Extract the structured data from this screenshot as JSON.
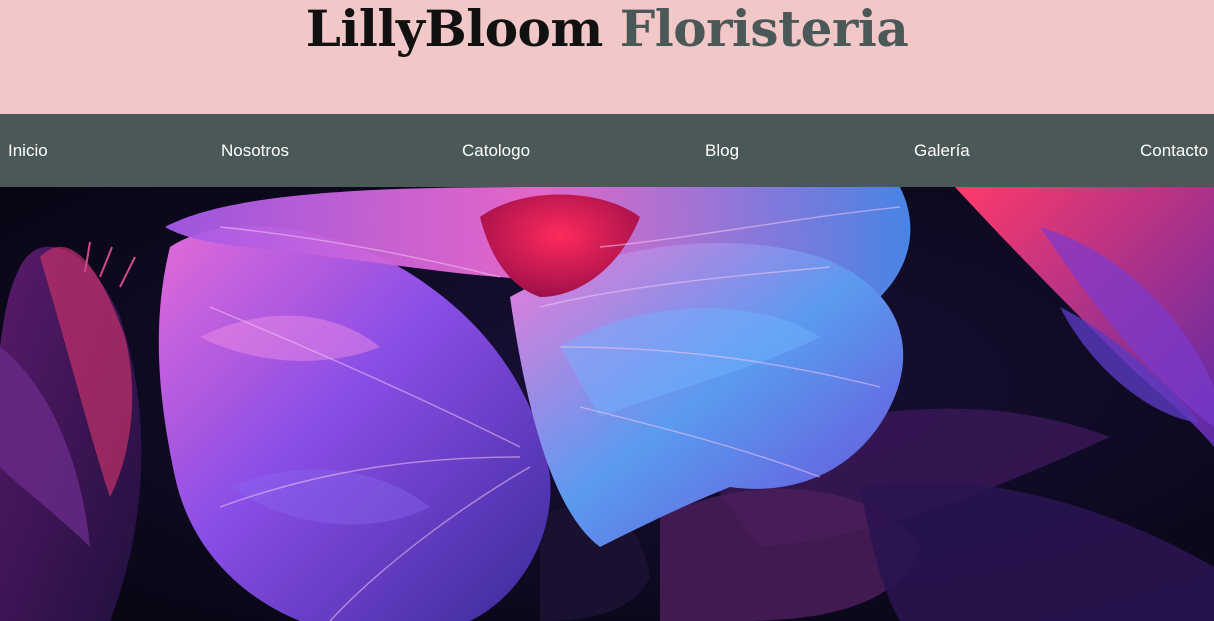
{
  "header": {
    "brand": "LillyBloom",
    "sub": "Floristeria"
  },
  "nav": {
    "items": [
      {
        "label": "Inicio"
      },
      {
        "label": "Nosotros"
      },
      {
        "label": "Catologo"
      },
      {
        "label": "Blog"
      },
      {
        "label": "Galería"
      },
      {
        "label": "Contacto"
      }
    ]
  },
  "colors": {
    "header_bg": "#f1c7c7",
    "nav_bg": "#4b5858",
    "brand_text": "#111111",
    "sub_text": "#4b5858",
    "nav_text": "#ffffff"
  },
  "hero": {
    "image": "neon-flower-photo"
  }
}
